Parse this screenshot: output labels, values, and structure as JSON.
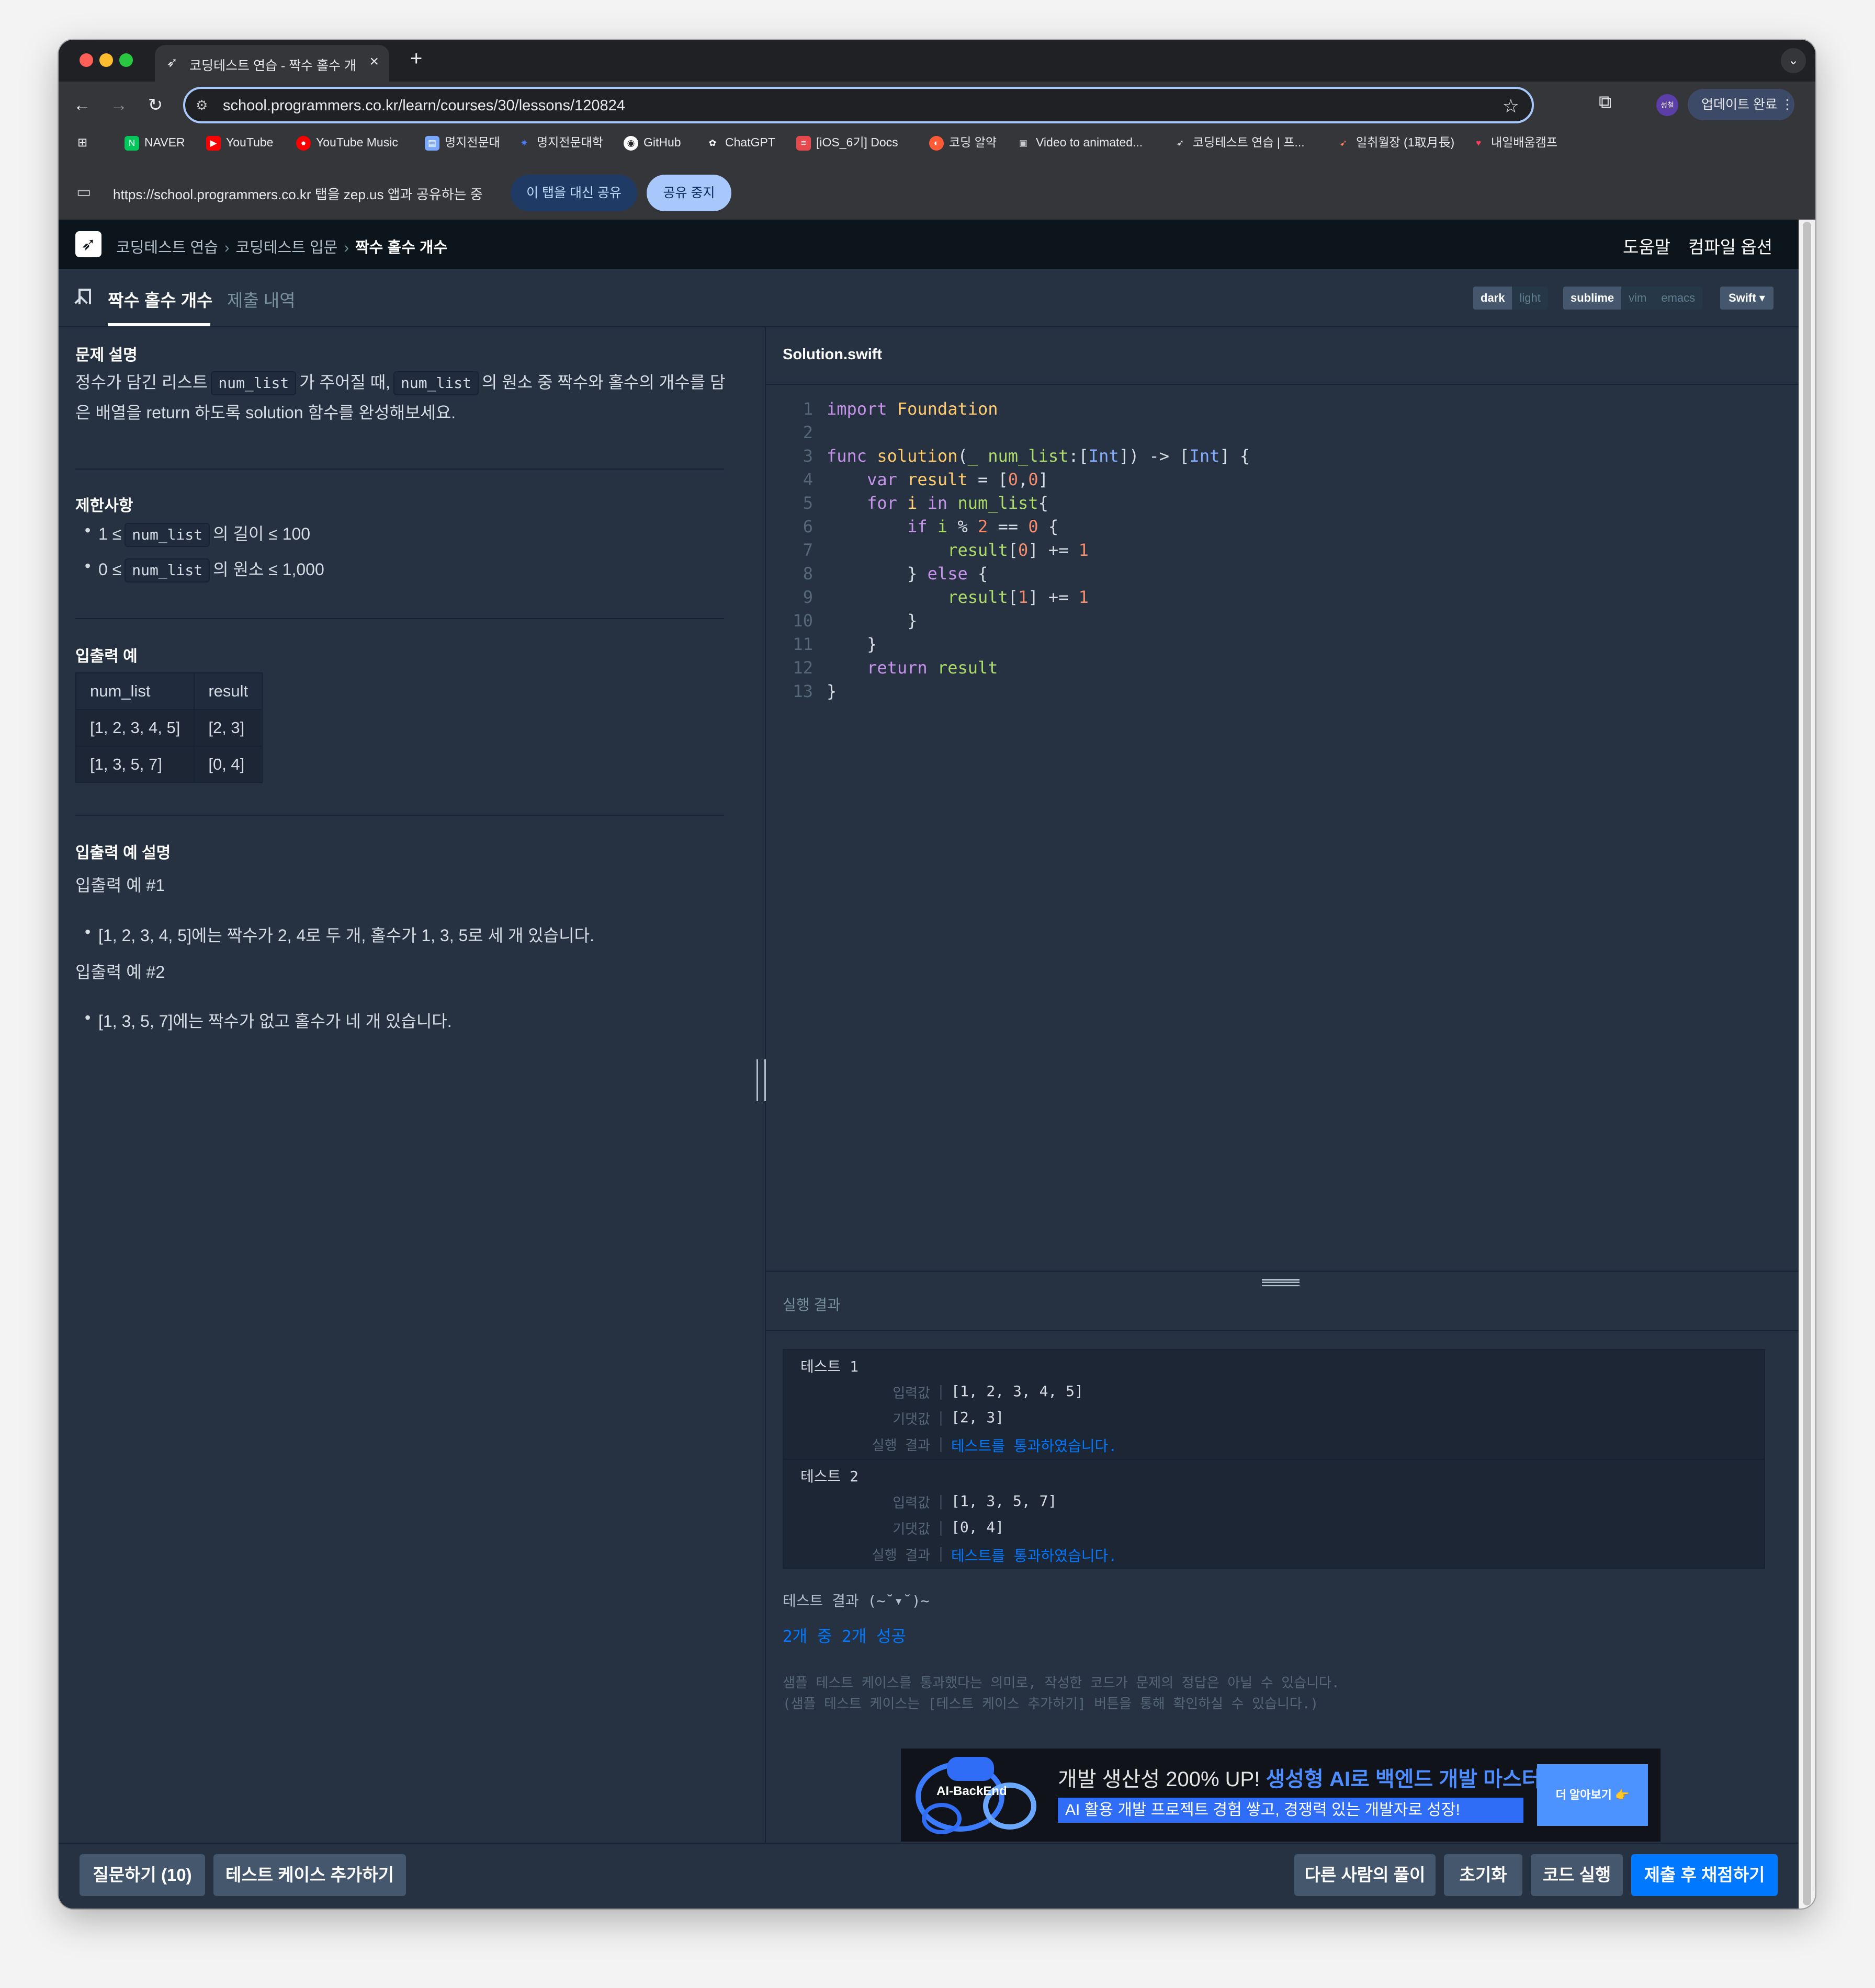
{
  "browser": {
    "tab_title": "코딩테스트 연습 - 짝수 홀수 개수 | 프로그래머스 스쿨",
    "url": "school.programmers.co.kr/learn/courses/30/lessons/120824",
    "profile_label": "성철",
    "update_label": "업데이트 완료",
    "bookmarks": [
      {
        "label": "NAVER",
        "icon": "naver-icon",
        "color": "#03c75a"
      },
      {
        "label": "YouTube",
        "icon": "youtube-icon",
        "color": "#ff0000"
      },
      {
        "label": "YouTube Music",
        "icon": "youtube-music-icon",
        "color": "#ff0000"
      },
      {
        "label": "명지전문대",
        "icon": "document-icon",
        "color": "#7aa7ff"
      },
      {
        "label": "명지전문대학",
        "icon": "sparkle-icon",
        "color": "#4f7cff"
      },
      {
        "label": "GitHub",
        "icon": "github-icon",
        "color": "#ffffff"
      },
      {
        "label": "ChatGPT",
        "icon": "chatgpt-icon",
        "color": "#ffffff"
      },
      {
        "label": "[iOS_6기] Docs",
        "icon": "docs-icon",
        "color": "#e5484d"
      },
      {
        "label": "코딩 알약",
        "icon": "pill-icon",
        "color": "#ff5a36"
      },
      {
        "label": "Video to animated...",
        "icon": "video-icon",
        "color": "#cccccc"
      },
      {
        "label": "코딩테스트 연습 | 프...",
        "icon": "programmers-icon",
        "color": "#ffffff"
      },
      {
        "label": "일취월장 (1取月長)",
        "icon": "rocket-icon",
        "color": "#ff7a59"
      },
      {
        "label": "내일배움캠프",
        "icon": "heart-icon",
        "color": "#ff3b5c"
      }
    ],
    "share_message": "https://school.programmers.co.kr 탭을 zep.us 앱과 공유하는 중",
    "share_alt_label": "이 탭을 대신 공유",
    "share_stop_label": "공유 중지"
  },
  "header": {
    "breadcrumb": [
      "코딩테스트 연습",
      "코딩테스트 입문",
      "짝수 홀수 개수"
    ],
    "help_label": "도움말",
    "compile_label": "컴파일 옵션"
  },
  "tabs": {
    "problem": "짝수 홀수 개수",
    "submissions": "제출 내역"
  },
  "editor_options": {
    "theme": [
      "dark",
      "light"
    ],
    "keymap": [
      "sublime",
      "vim",
      "emacs"
    ],
    "language": "Swift"
  },
  "problem": {
    "desc_title": "문제 설명",
    "desc_p1_a": "정수가 담긴 리스트",
    "desc_code": "num_list",
    "desc_p1_b": "가 주어질 때,",
    "desc_p1_c": "의 원소 중 짝수와 홀수의 개수를 담",
    "desc_p2": "은 배열을 return 하도록 solution 함수를 완성해보세요.",
    "constraints_title": "제한사항",
    "c1_a": "1 ≤",
    "c1_b": "의 길이 ≤ 100",
    "c2_a": "0 ≤",
    "c2_b": "의 원소 ≤ 1,000",
    "io_title": "입출력 예",
    "io_headers": [
      "num_list",
      "result"
    ],
    "io_rows": [
      [
        "[1, 2, 3, 4, 5]",
        "[2, 3]"
      ],
      [
        "[1, 3, 5, 7]",
        "[0, 4]"
      ]
    ],
    "explain_title": "입출력 예 설명",
    "ex1_title": "입출력 예 #1",
    "ex1_text": "[1, 2, 3, 4, 5]에는 짝수가 2, 4로 두 개, 홀수가 1, 3, 5로 세 개 있습니다.",
    "ex2_title": "입출력 예 #2",
    "ex2_text": "[1, 3, 5, 7]에는 짝수가 없고 홀수가 네 개 있습니다."
  },
  "editor": {
    "filename": "Solution.swift",
    "line_numbers": [
      "1",
      "2",
      "3",
      "4",
      "5",
      "6",
      "7",
      "8",
      "9",
      "10",
      "11",
      "12",
      "13"
    ]
  },
  "results": {
    "title": "실행 결과",
    "tests": [
      {
        "name": "테스트 1",
        "input_label": "입력값",
        "input": "[1, 2, 3, 4, 5]",
        "expected_label": "기댓값",
        "expected": "[2, 3]",
        "result_label": "실행 결과",
        "result": "테스트를 통과하였습니다."
      },
      {
        "name": "테스트 2",
        "input_label": "입력값",
        "input": "[1, 3, 5, 7]",
        "expected_label": "기댓값",
        "expected": "[0, 4]",
        "result_label": "실행 결과",
        "result": "테스트를 통과하였습니다."
      }
    ],
    "summary_title": "테스트 결과 (~˘▾˘)~",
    "summary_count": "2개 중 2개 성공",
    "note1": "샘플 테스트 케이스를 통과했다는 의미로, 작성한 코드가 문제의 정답은 아닐 수 있습니다.",
    "note2": "(샘플 테스트 케이스는 [테스트 케이스 추가하기] 버튼을 통해 확인하실 수 있습니다.)"
  },
  "banner": {
    "art_text": "AI-BackEnd",
    "line1_a": "개발 생산성 200% UP!",
    "line1_b": "생성형 AI로 백엔드 개발 마스터",
    "line2": "AI 활용 개발 프로젝트 경험 쌓고, 경쟁력 있는 개발자로 성장!",
    "more_label": "더 알아보기 👉"
  },
  "bottom": {
    "question_label": "질문하기 (10)",
    "add_case_label": "테스트 케이스 추가하기",
    "others_label": "다른 사람의 풀이",
    "reset_label": "초기화",
    "run_label": "코드 실행",
    "submit_label": "제출 후 채점하기"
  }
}
